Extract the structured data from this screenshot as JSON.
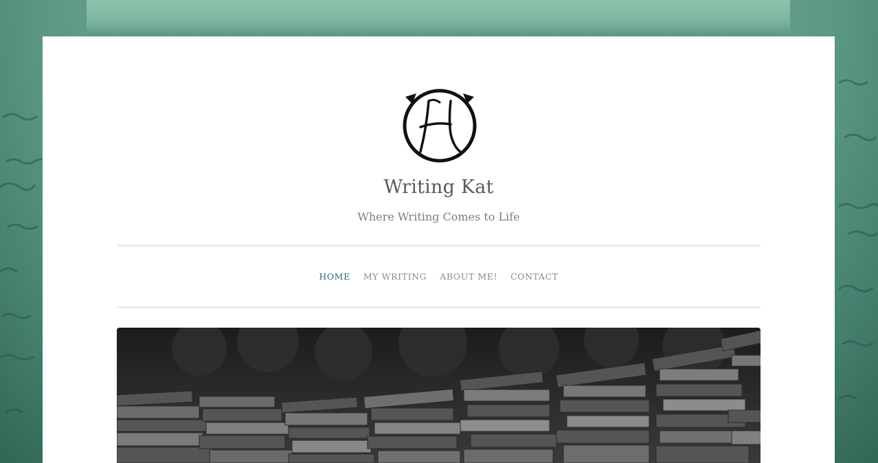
{
  "site": {
    "title": "Writing Kat",
    "tagline": "Where Writing Comes to Life",
    "logo_icon": "cat-k-logo-icon"
  },
  "nav": {
    "items": [
      {
        "label": "HOME",
        "active": true
      },
      {
        "label": "MY WRITING",
        "active": false
      },
      {
        "label": "ABOUT ME!",
        "active": false
      },
      {
        "label": "CONTACT",
        "active": false
      }
    ]
  },
  "colors": {
    "background": "#5f9c8a",
    "accent": "#2b6c70",
    "title": "#5a5a5a",
    "nav": "#8a8a8a"
  },
  "hero": {
    "image_icon": "stacked-books-image"
  }
}
